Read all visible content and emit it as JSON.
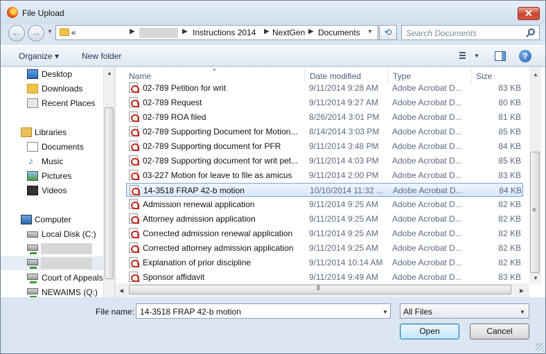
{
  "window": {
    "title": "File Upload",
    "close_glyph": "✕",
    "app_icon": "firefox-icon"
  },
  "address_bar": {
    "overflow_marker": "«",
    "crumbs": [
      "Instructions 2014",
      "NextGen",
      "Documents"
    ],
    "separator": "▶",
    "refresh_glyph": "⟲"
  },
  "search": {
    "placeholder": "Search Documents"
  },
  "toolbar": {
    "organize_label": "Organize ▾",
    "new_folder_label": "New folder",
    "view_dd": "▼",
    "help_glyph": "?"
  },
  "nav": {
    "desktop": "Desktop",
    "downloads": "Downloads",
    "recent_places": "Recent Places",
    "libraries": "Libraries",
    "documents": "Documents",
    "music": "Music",
    "pictures": "Pictures",
    "videos": "Videos",
    "computer": "Computer",
    "local_disk": "Local Disk (C:)",
    "court_of_appeals": "Court of Appeals",
    "newaims": "NEWAIMS (Q:)",
    "music_glyph": "♪"
  },
  "columns": {
    "name": "Name",
    "date_modified": "Date modified",
    "type": "Type",
    "size": "Size",
    "sort_glyph": "▲"
  },
  "files": [
    {
      "name": "02-789 Petition for writ",
      "date": "9/11/2014 9:28 AM",
      "type": "Adobe Acrobat D...",
      "size": "83 KB"
    },
    {
      "name": "02-789 Request",
      "date": "9/11/2014 9:27 AM",
      "type": "Adobe Acrobat D...",
      "size": "80 KB"
    },
    {
      "name": "02-789 ROA filed",
      "date": "8/26/2014 3:01 PM",
      "type": "Adobe Acrobat D...",
      "size": "81 KB"
    },
    {
      "name": "02-789 Supporting Document for Motion...",
      "date": "8/14/2014 3:03 PM",
      "type": "Adobe Acrobat D...",
      "size": "85 KB"
    },
    {
      "name": "02-789 Supporting document for PFR",
      "date": "9/11/2014 3:48 PM",
      "type": "Adobe Acrobat D...",
      "size": "84 KB"
    },
    {
      "name": "02-789 Supporting document for writ pet...",
      "date": "9/11/2014 4:03 PM",
      "type": "Adobe Acrobat D...",
      "size": "85 KB"
    },
    {
      "name": "03-227 Motion for leave to file as amicus",
      "date": "9/11/2014 2:00 PM",
      "type": "Adobe Acrobat D...",
      "size": "83 KB"
    },
    {
      "name": "14-3518 FRAP 42-b motion",
      "date": "10/10/2014 11:32 ...",
      "type": "Adobe Acrobat D...",
      "size": "84 KB"
    },
    {
      "name": "Admission renewal application",
      "date": "9/11/2014 9:25 AM",
      "type": "Adobe Acrobat D...",
      "size": "82 KB"
    },
    {
      "name": "Attorney admission application",
      "date": "9/11/2014 9:25 AM",
      "type": "Adobe Acrobat D...",
      "size": "82 KB"
    },
    {
      "name": "Corrected admission renewal application",
      "date": "9/11/2014 9:25 AM",
      "type": "Adobe Acrobat D...",
      "size": "82 KB"
    },
    {
      "name": "Corrected attorney admission application",
      "date": "9/11/2014 9:25 AM",
      "type": "Adobe Acrobat D...",
      "size": "82 KB"
    },
    {
      "name": "Explanation of prior discipline",
      "date": "9/11/2014 10:14 AM",
      "type": "Adobe Acrobat D...",
      "size": "82 KB"
    },
    {
      "name": "Sponsor affidavit",
      "date": "9/11/2014 9:49 AM",
      "type": "Adobe Acrobat D...",
      "size": "83 KB"
    }
  ],
  "selected_file_index": 7,
  "footer": {
    "file_name_label": "File name:",
    "file_name_value": "14-3518 FRAP 42-b motion",
    "file_type_value": "All Files",
    "open_label": "Open",
    "cancel_label": "Cancel",
    "dropdown_glyph": "▼"
  },
  "scroll_glyphs": {
    "up": "▲",
    "down": "▼",
    "left": "◀",
    "right": "▶"
  },
  "colors": {
    "selection_border": "#7da2ce",
    "default_button_border": "#3c7fb1",
    "close_button": "#c9452f"
  }
}
